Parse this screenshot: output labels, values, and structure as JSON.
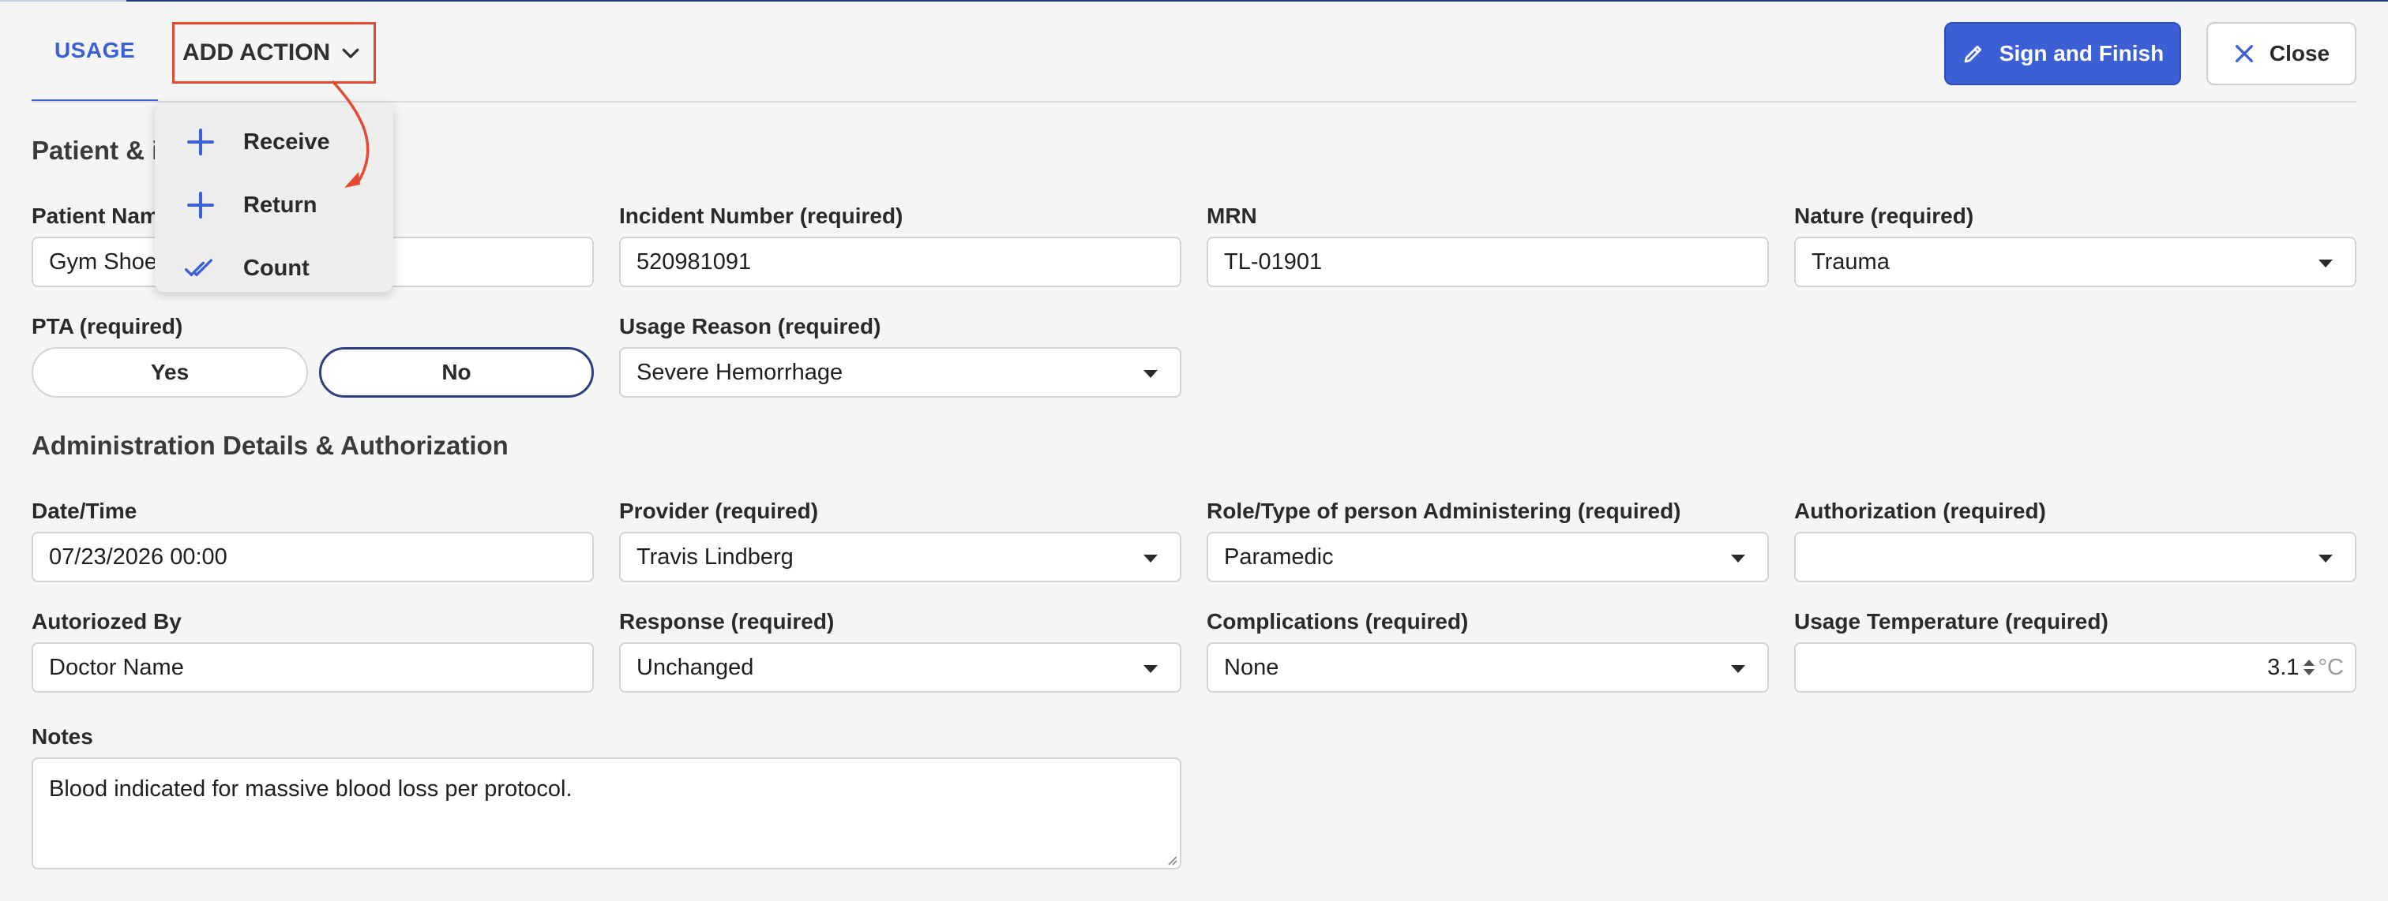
{
  "header": {
    "tab_usage": "USAGE",
    "add_action_label": "ADD ACTION",
    "sign_label": "Sign and Finish",
    "close_label": "Close"
  },
  "menu": {
    "items": [
      {
        "label": "Receive",
        "icon": "plus-icon"
      },
      {
        "label": "Return",
        "icon": "plus-icon"
      },
      {
        "label": "Count",
        "icon": "double-check-icon"
      }
    ]
  },
  "patient_section": {
    "title": "Patient & i",
    "patient_name": {
      "label": "Patient Nam",
      "value": "Gym Shoe"
    },
    "incident_number": {
      "label": "Incident Number (required)",
      "value": "520981091"
    },
    "mrn": {
      "label": "MRN",
      "value": "TL-01901"
    },
    "nature": {
      "label": "Nature (required)",
      "value": "Trauma"
    },
    "pta": {
      "label": "PTA (required)",
      "yes": "Yes",
      "no": "No",
      "selected": "No"
    },
    "usage_reason": {
      "label": "Usage Reason (required)",
      "value": "Severe Hemorrhage"
    }
  },
  "admin_section": {
    "title": "Administration Details & Authorization",
    "datetime": {
      "label": "Date/Time",
      "value": "07/23/2026 00:00"
    },
    "provider": {
      "label": "Provider (required)",
      "value": "Travis Lindberg"
    },
    "role": {
      "label": "Role/Type of person Administering (required)",
      "value": "Paramedic"
    },
    "authorization": {
      "label": "Authorization (required)",
      "value": ""
    },
    "authorized_by": {
      "label": "Autoriozed By",
      "value": "Doctor Name"
    },
    "response": {
      "label": "Response (required)",
      "value": "Unchanged"
    },
    "complications": {
      "label": "Complications (required)",
      "value": "None"
    },
    "usage_temp": {
      "label": "Usage Temperature (required)",
      "value": "3.1",
      "unit": "°C"
    },
    "notes": {
      "label": "Notes",
      "value": "Blood indicated for massive blood loss per protocol."
    }
  },
  "colors": {
    "primary": "#3c5fd6",
    "annotation": "#e24a33",
    "toggle_selected": "#2b3f7d"
  }
}
